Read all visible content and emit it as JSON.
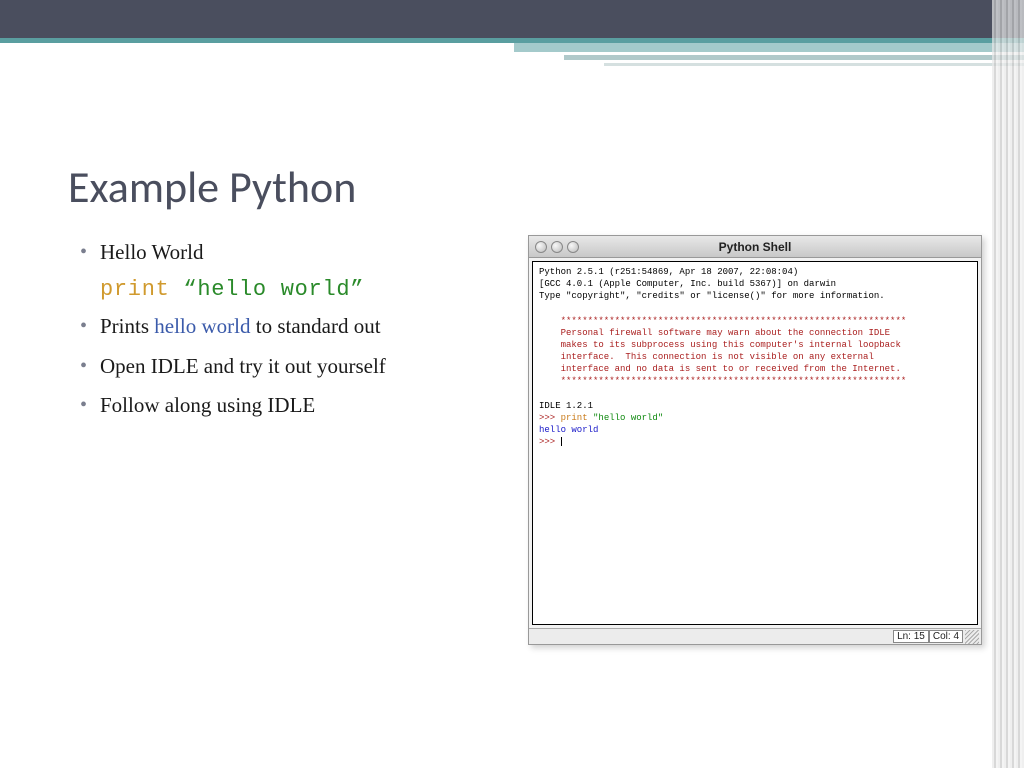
{
  "slide": {
    "title": "Example Python"
  },
  "bullets": {
    "b1": "Hello World",
    "code_print": "print",
    "code_string": "“hello world”",
    "b2_pre": "Prints ",
    "b2_hl": "hello world",
    "b2_post": " to standard out",
    "b3": "Open IDLE and try it out yourself",
    "b4": "Follow along using IDLE"
  },
  "shell": {
    "title": "Python Shell",
    "header_line1": "Python 2.5.1 (r251:54869, Apr 18 2007, 22:08:04)",
    "header_line2": "[GCC 4.0.1 (Apple Computer, Inc. build 5367)] on darwin",
    "header_line3": "Type \"copyright\", \"credits\" or \"license()\" for more information.",
    "warn_border": "    ****************************************************************",
    "warn_l1": "    Personal firewall software may warn about the connection IDLE",
    "warn_l2": "    makes to its subprocess using this computer's internal loopback",
    "warn_l3": "    interface.  This connection is not visible on any external",
    "warn_l4": "    interface and no data is sent to or received from the Internet.",
    "idle_ver": "IDLE 1.2.1",
    "prompt": ">>> ",
    "cmd_print": "print ",
    "cmd_string": "\"hello world\"",
    "output": "hello world",
    "status_ln_label": "Ln: ",
    "status_ln_val": "15",
    "status_col_label": "Col: ",
    "status_col_val": "4"
  }
}
